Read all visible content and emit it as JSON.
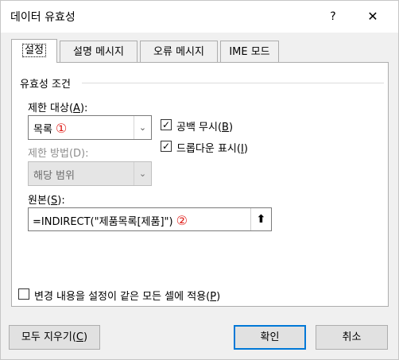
{
  "window": {
    "title": "데이터 유효성",
    "help": "?",
    "close": "✕"
  },
  "tabs": [
    {
      "label": "설정"
    },
    {
      "label": "설명 메시지"
    },
    {
      "label": "오류 메시지"
    },
    {
      "label": "IME 모드"
    }
  ],
  "settings": {
    "group_label": "유효성 조건",
    "allow_label": "제한 대상(",
    "allow_key": "A",
    "allow_suffix": "):",
    "allow_value": "목록",
    "marker1": "①",
    "data_label": "제한 방법(D):",
    "data_value": "해당 범위",
    "ignore_blank_label": "공백 무시(",
    "ignore_blank_key": "B",
    "ignore_blank_suffix": ")",
    "ignore_blank_checked": true,
    "dropdown_label": "드롭다운 표시(",
    "dropdown_key": "I",
    "dropdown_suffix": ")",
    "dropdown_checked": true,
    "source_label": "원본(",
    "source_key": "S",
    "source_suffix": "):",
    "source_value": "=INDIRECT(\"제품목록[제품]\")",
    "marker2": "②",
    "apply_all_label": "변경 내용을 설정이 같은 모든 셀에 적용(",
    "apply_all_key": "P",
    "apply_all_suffix": ")",
    "apply_all_checked": false
  },
  "buttons": {
    "clear_label": "모두 지우기(",
    "clear_key": "C",
    "clear_suffix": ")",
    "ok": "확인",
    "cancel": "취소"
  },
  "icons": {
    "dropdown": "chevron-down-icon",
    "collapse": "collapse-dialog-icon",
    "check": "checkmark-icon"
  }
}
